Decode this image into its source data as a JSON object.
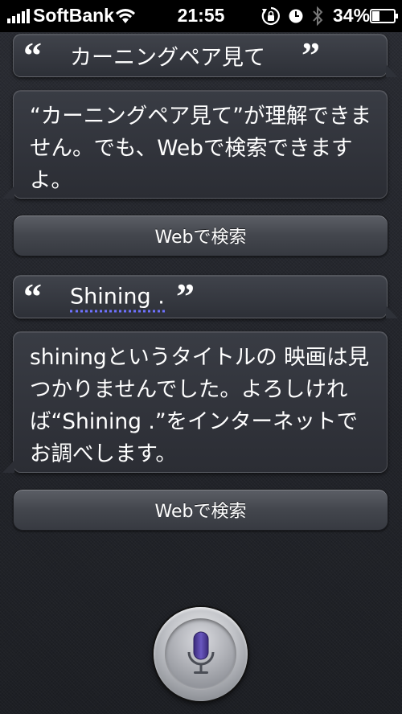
{
  "status_bar": {
    "carrier": "SoftBank",
    "time": "21:55",
    "battery_percent": "34%"
  },
  "conversation": [
    {
      "role": "user",
      "open_quote": "“",
      "text": "カーニングペア見て",
      "close_quote": "”"
    },
    {
      "role": "assistant",
      "text": "“カーニングペア見て”が理解できません。でも、Webで検索できますよ。"
    },
    {
      "role": "action",
      "label": "Webで検索"
    },
    {
      "role": "user",
      "open_quote": "“",
      "text": "Shining .",
      "close_quote": "”"
    },
    {
      "role": "assistant",
      "text": "shiningというタイトルの 映画は見つかりませんでした。よろしければ“Shining .”をインターネットでお調べします。"
    },
    {
      "role": "action",
      "label": "Webで検索"
    }
  ],
  "icons": {
    "signal": "signal-icon",
    "wifi": "wifi-icon",
    "rotation_lock": "rotation-lock-icon",
    "alarm": "alarm-icon",
    "bluetooth": "bluetooth-icon",
    "battery": "battery-icon",
    "microphone": "microphone-icon"
  },
  "colors": {
    "background": "#23252b",
    "mic_purple": "#4a3a8c",
    "underline": "#6f72ff"
  }
}
